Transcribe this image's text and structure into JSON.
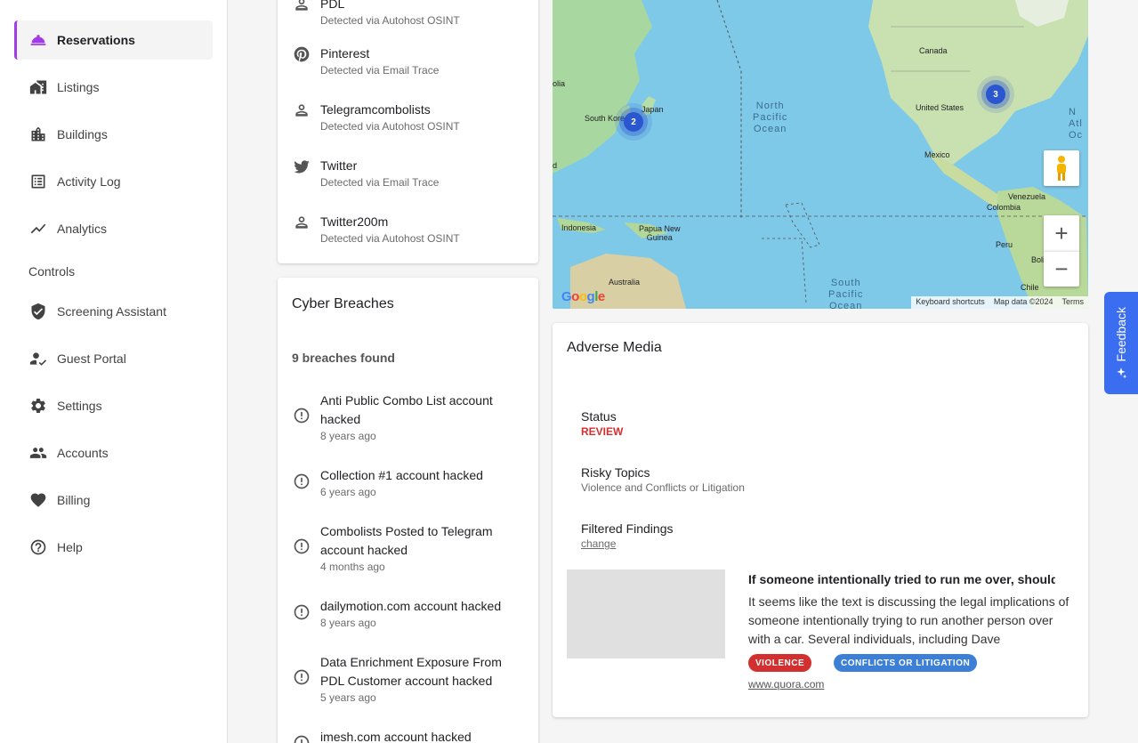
{
  "sidebar": {
    "items": [
      {
        "label": "Reservations",
        "icon": "reservation-bell-icon"
      },
      {
        "label": "Listings",
        "icon": "house-icon"
      },
      {
        "label": "Buildings",
        "icon": "building-icon"
      },
      {
        "label": "Activity Log",
        "icon": "list-icon"
      },
      {
        "label": "Analytics",
        "icon": "trend-line-icon"
      }
    ],
    "controls_heading": "Controls",
    "control_items": [
      {
        "label": "Screening Assistant",
        "icon": "shield-check-icon"
      },
      {
        "label": "Guest Portal",
        "icon": "person-check-icon"
      },
      {
        "label": "Settings",
        "icon": "gear-icon"
      },
      {
        "label": "Accounts",
        "icon": "people-icon"
      },
      {
        "label": "Billing",
        "icon": "heart-icon"
      },
      {
        "label": "Help",
        "icon": "help-circle-icon"
      }
    ]
  },
  "social_profiles": {
    "items": [
      {
        "name": "PDL",
        "source": "Detected via Autohost OSINT",
        "icon": "person-icon"
      },
      {
        "name": "Pinterest",
        "source": "Detected via Email Trace",
        "icon": "pinterest-icon"
      },
      {
        "name": "Telegramcombolists",
        "source": "Detected via Autohost OSINT",
        "icon": "person-icon"
      },
      {
        "name": "Twitter",
        "source": "Detected via Email Trace",
        "icon": "twitter-icon"
      },
      {
        "name": "Twitter200m",
        "source": "Detected via Autohost OSINT",
        "icon": "person-icon"
      }
    ]
  },
  "cyber_breaches": {
    "title": "Cyber Breaches",
    "count_text": "9 breaches found",
    "items": [
      {
        "title": "Anti Public Combo List account hacked",
        "when": "8 years ago"
      },
      {
        "title": "Collection #1 account hacked",
        "when": "6 years ago"
      },
      {
        "title": "Combolists Posted to Telegram account hacked",
        "when": "4 months ago"
      },
      {
        "title": "dailymotion.com account hacked",
        "when": "8 years ago"
      },
      {
        "title": "Data Enrichment Exposure From PDL Customer account hacked",
        "when": "5 years ago"
      },
      {
        "title": "imesh.com account hacked",
        "when": ""
      }
    ]
  },
  "map": {
    "labels": {
      "canada": "Canada",
      "united_states": "United States",
      "mexico": "Mexico",
      "japan": "Japan",
      "south_korea": "South Kore",
      "mongolia": "olia",
      "indonesia": "Indonesia",
      "papua": "Papua New\nGuinea",
      "australia": "Australia",
      "venezuela": "Venezuela",
      "colombia": "Colombia",
      "peru": "Peru",
      "bolivia": "Bolivi",
      "chile": "Chile",
      "ind": "d"
    },
    "oceans": {
      "north_pacific": "North\nPacific\nOcean",
      "south_pacific": "South\nPacific\nOcean",
      "north_atlantic": "N\nAtl\nOc"
    },
    "clusters": [
      {
        "count": "2",
        "region": "Japan"
      },
      {
        "count": "3",
        "region": "Eastern US"
      }
    ],
    "zoom_in": "+",
    "zoom_out": "−",
    "logo": "Google",
    "footer": [
      "Keyboard shortcuts",
      "Map data ©2024",
      "Terms"
    ]
  },
  "adverse_media": {
    "title": "Adverse Media",
    "status_label": "Status",
    "status_value": "REVIEW",
    "risky_label": "Risky Topics",
    "risky_value": "Violence and Conflicts or Litigation",
    "filtered_label": "Filtered Findings",
    "filtered_link": "change",
    "article": {
      "title": "If someone intentionally tried to run me over, should …",
      "snippet": "It seems like the text is discussing the legal implications of someone intentionally trying to run another person over with a car. Several individuals, including Dave Hollenbec…",
      "tags": [
        {
          "label": "VIOLENCE",
          "color": "#d32f2f"
        },
        {
          "label": "CONFLICTS OR LITIGATION",
          "color": "#3d7fd6"
        }
      ],
      "source": "www.quora.com"
    }
  },
  "feedback": {
    "label": "Feedback"
  },
  "colors": {
    "accent": "#a23ce6",
    "review": "#d32f2f",
    "feedback": "#3b6df0"
  }
}
